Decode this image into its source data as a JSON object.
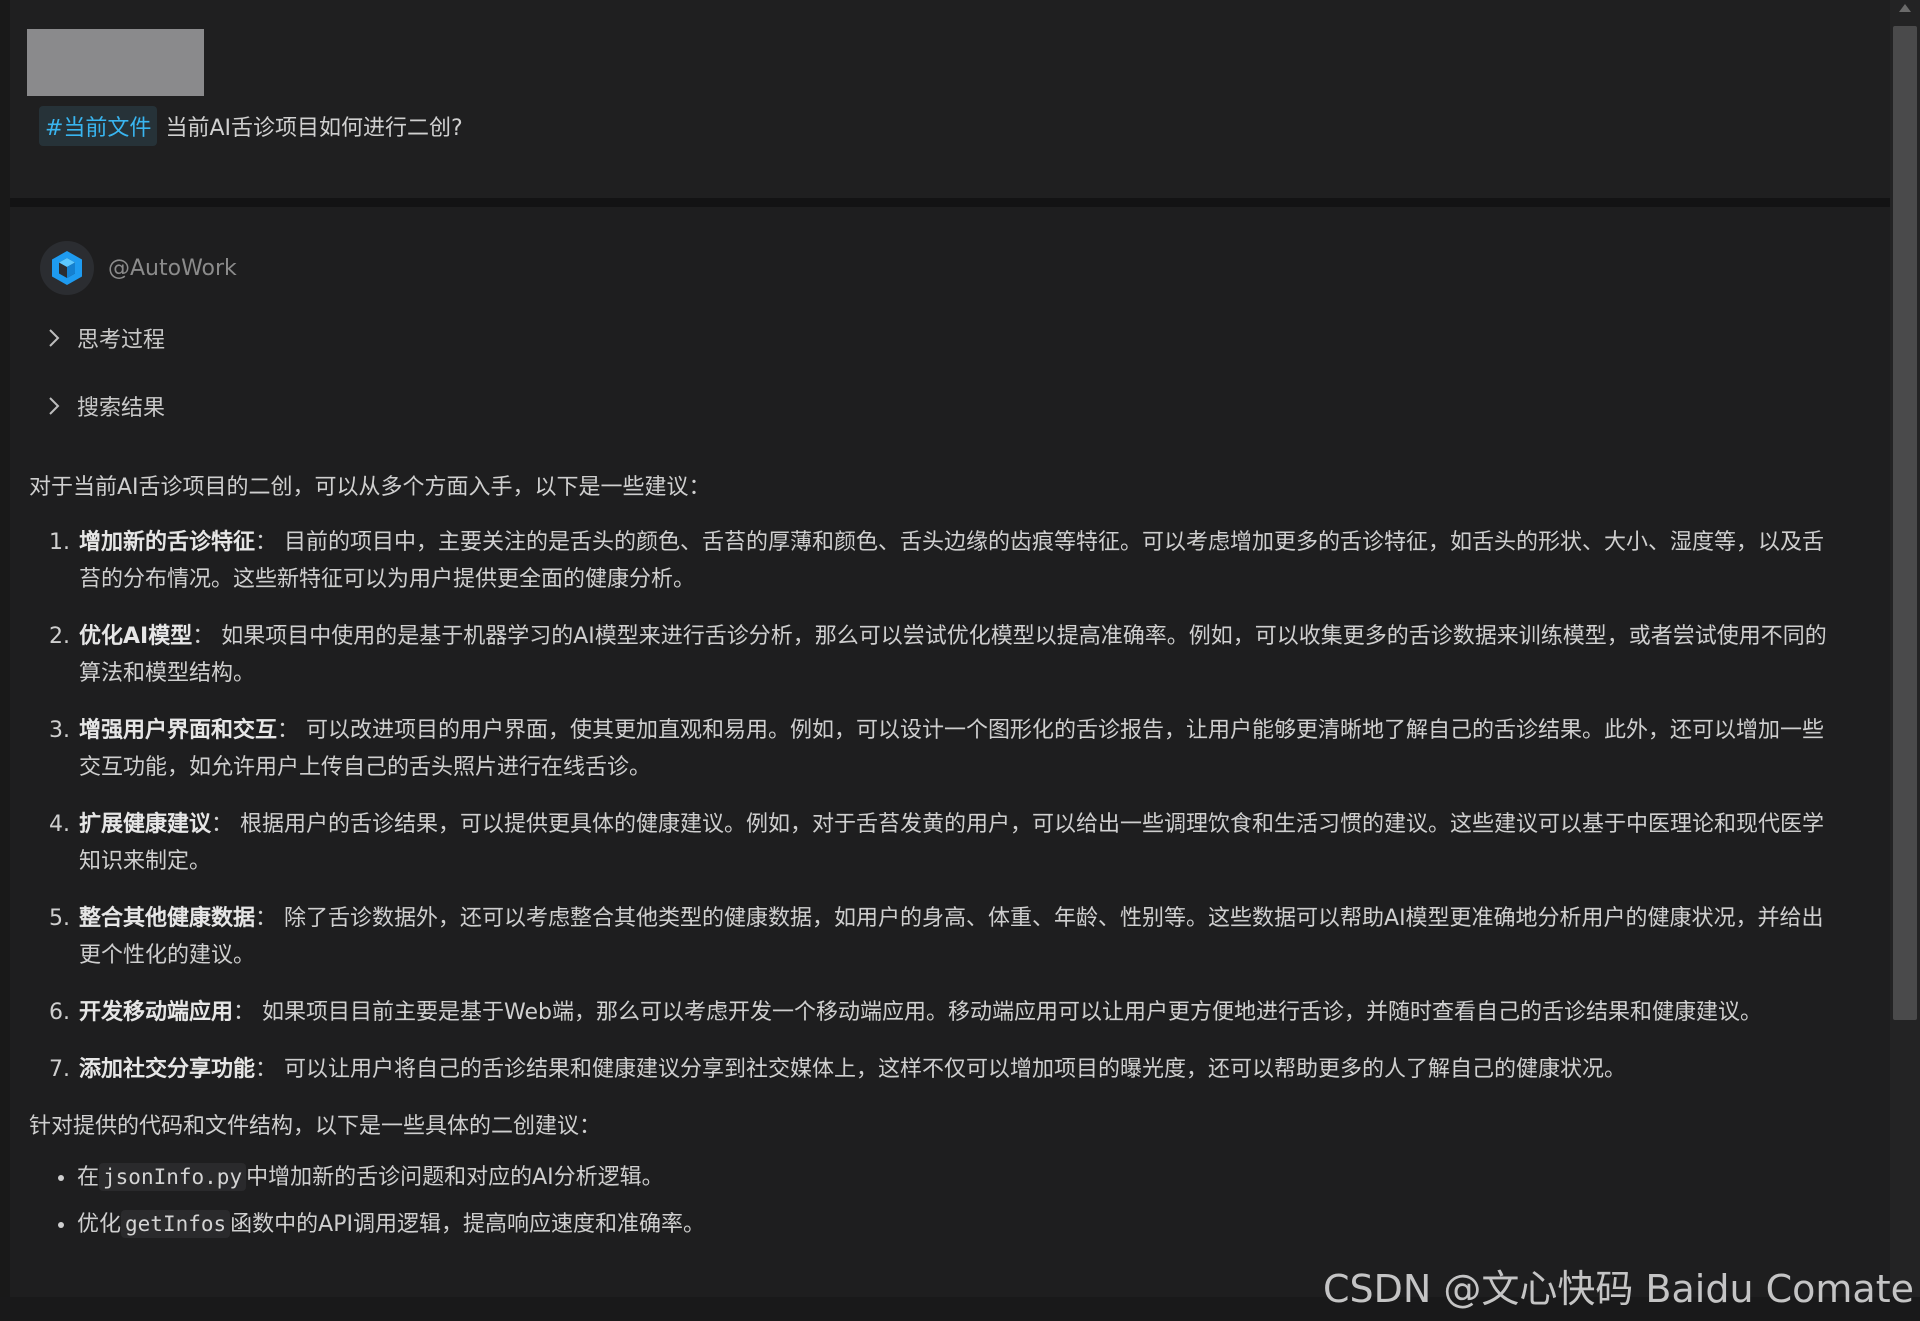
{
  "user_message": {
    "file_tag": "#当前文件",
    "text": "当前AI舌诊项目如何进行二创?"
  },
  "assistant": {
    "name": "@AutoWork",
    "collapsibles": [
      "思考过程",
      "搜索结果"
    ],
    "intro": "对于当前AI舌诊项目的二创，可以从多个方面入手，以下是一些建议：",
    "items": [
      {
        "title": "增加新的舌诊特征",
        "text": "：  目前的项目中，主要关注的是舌头的颜色、舌苔的厚薄和颜色、舌头边缘的齿痕等特征。可以考虑增加更多的舌诊特征，如舌头的形状、大小、湿度等，以及舌苔的分布情况。这些新特征可以为用户提供更全面的健康分析。"
      },
      {
        "title": "优化AI模型",
        "text": "：  如果项目中使用的是基于机器学习的AI模型来进行舌诊分析，那么可以尝试优化模型以提高准确率。例如，可以收集更多的舌诊数据来训练模型，或者尝试使用不同的算法和模型结构。"
      },
      {
        "title": "增强用户界面和交互",
        "text": "：  可以改进项目的用户界面，使其更加直观和易用。例如，可以设计一个图形化的舌诊报告，让用户能够更清晰地了解自己的舌诊结果。此外，还可以增加一些交互功能，如允许用户上传自己的舌头照片进行在线舌诊。"
      },
      {
        "title": "扩展健康建议",
        "text": "：  根据用户的舌诊结果，可以提供更具体的健康建议。例如，对于舌苔发黄的用户，可以给出一些调理饮食和生活习惯的建议。这些建议可以基于中医理论和现代医学知识来制定。"
      },
      {
        "title": "整合其他健康数据",
        "text": "：  除了舌诊数据外，还可以考虑整合其他类型的健康数据，如用户的身高、体重、年龄、性别等。这些数据可以帮助AI模型更准确地分析用户的健康状况，并给出更个性化的建议。"
      },
      {
        "title": "开发移动端应用",
        "text": "：  如果项目目前主要是基于Web端，那么可以考虑开发一个移动端应用。移动端应用可以让用户更方便地进行舌诊，并随时查看自己的舌诊结果和健康建议。"
      },
      {
        "title": "添加社交分享功能",
        "text": "：  可以让用户将自己的舌诊结果和健康建议分享到社交媒体上，这样不仅可以增加项目的曝光度，还可以帮助更多的人了解自己的健康状况。"
      }
    ],
    "outro": "针对提供的代码和文件结构，以下是一些具体的二创建议：",
    "bullets": [
      {
        "pre": "在",
        "code": "jsonInfo.py",
        "post": "中增加新的舌诊问题和对应的AI分析逻辑。"
      },
      {
        "pre": "优化",
        "code": "getInfos",
        "post": "函数中的API调用逻辑，提高响应速度和准确率。"
      }
    ]
  },
  "watermark": "CSDN @文心快码 Baidu Comate",
  "colors": {
    "background": "#1e1e1f",
    "tag_text": "#39b5f0",
    "logo_blue": "#1e9bf0"
  }
}
